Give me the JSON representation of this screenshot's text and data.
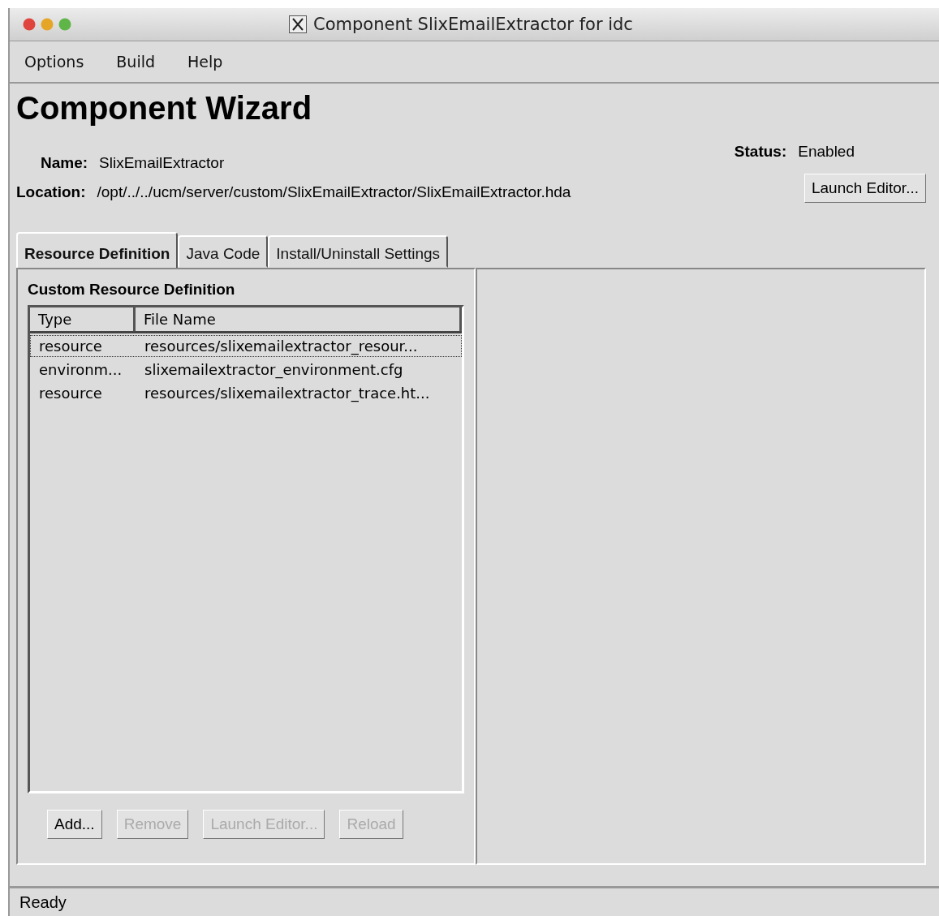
{
  "window": {
    "title": "Component SlixEmailExtractor for idc"
  },
  "menu": [
    "Options",
    "Build",
    "Help"
  ],
  "heading": "Component Wizard",
  "info": {
    "name_label": "Name:",
    "name": "SlixEmailExtractor",
    "location_label": "Location:",
    "location": "/opt/../../ucm/server/custom/SlixEmailExtractor/SlixEmailExtractor.hda",
    "status_label": "Status:",
    "status": "Enabled",
    "launch_button": "Launch Editor..."
  },
  "tabs": [
    {
      "label": "Resource Definition",
      "selected": true
    },
    {
      "label": "Java Code",
      "selected": false
    },
    {
      "label": "Install/Uninstall Settings",
      "selected": false
    }
  ],
  "panel": {
    "title": "Custom Resource Definition",
    "table": {
      "columns": [
        "Type",
        "File Name"
      ],
      "rows": [
        {
          "cells": [
            "resource",
            "resources/slixemailextractor_resour..."
          ],
          "selected": true
        },
        {
          "cells": [
            "environm...",
            "slixemailextractor_environment.cfg"
          ],
          "selected": false
        },
        {
          "cells": [
            "resource",
            "resources/slixemailextractor_trace.ht..."
          ],
          "selected": false
        }
      ]
    },
    "buttons": [
      {
        "label": "Add...",
        "disabled": false
      },
      {
        "label": "Remove",
        "disabled": true
      },
      {
        "label": "Launch Editor...",
        "disabled": true
      },
      {
        "label": "Reload",
        "disabled": true
      }
    ]
  },
  "status_bar": "Ready"
}
